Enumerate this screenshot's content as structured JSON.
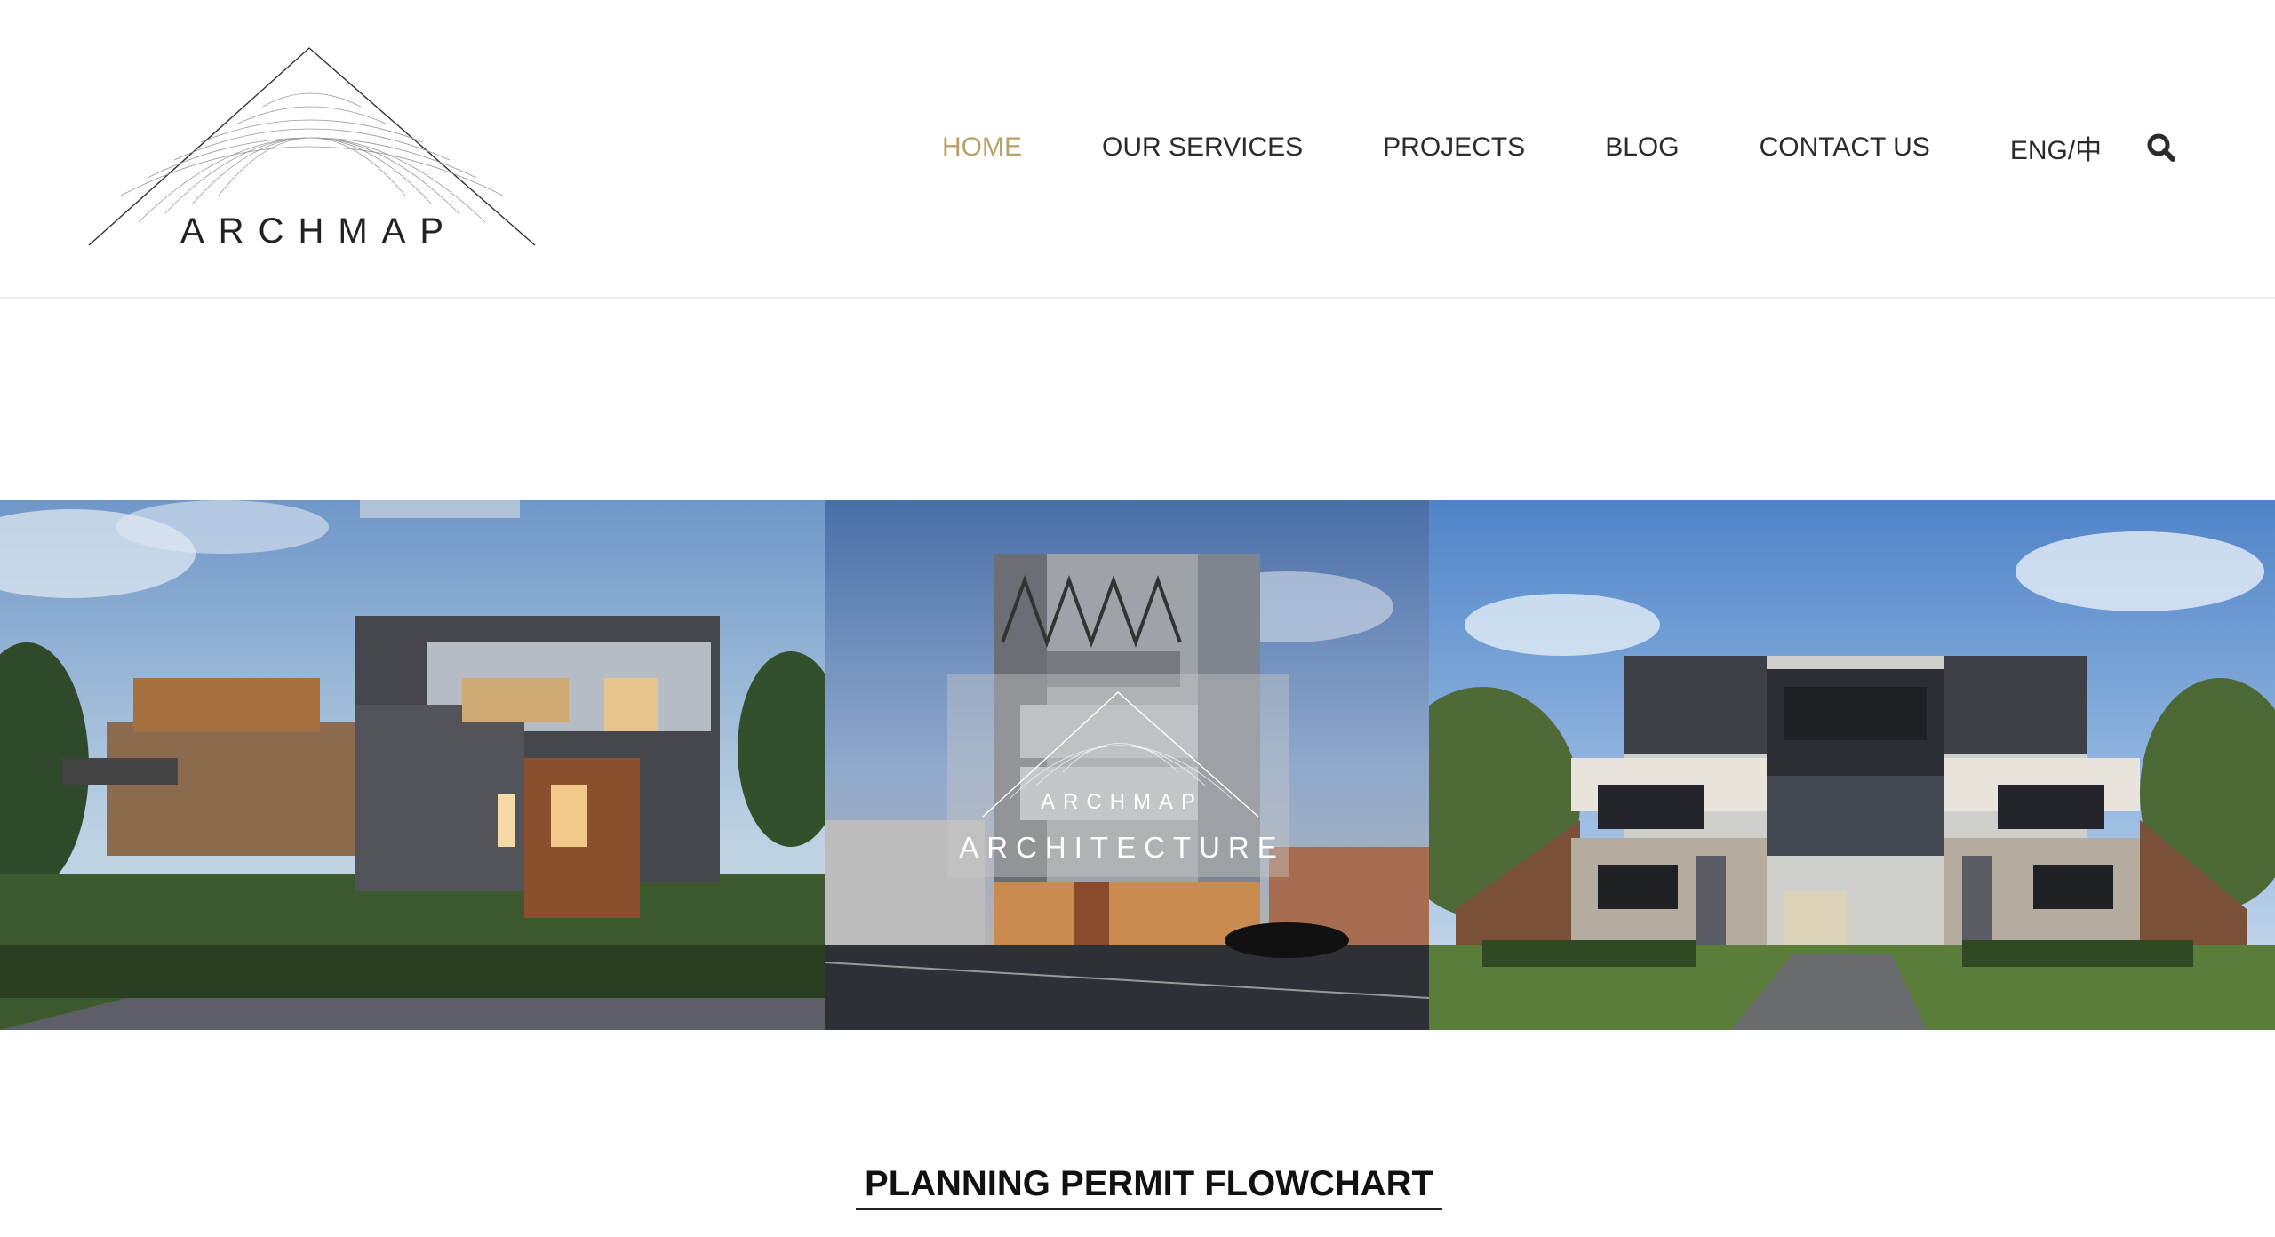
{
  "logo": {
    "text": "ARCHMAP"
  },
  "nav": {
    "items": [
      {
        "label": "HOME",
        "active": true
      },
      {
        "label": "OUR SERVICES",
        "active": false
      },
      {
        "label": "PROJECTS",
        "active": false
      },
      {
        "label": "BLOG",
        "active": false
      },
      {
        "label": "CONTACT US",
        "active": false
      },
      {
        "label": "ENG/中",
        "active": false
      }
    ],
    "search_icon": "search-icon"
  },
  "banner": {
    "overlay": {
      "brand": "ARCHMAP",
      "subtitle": "ARCHITECTURE"
    }
  },
  "section": {
    "title": "PLANNING PERMIT FLOWCHART"
  },
  "colors": {
    "accent": "#b8a169",
    "nav_text": "#2b2b2b",
    "title_text": "#111111"
  }
}
